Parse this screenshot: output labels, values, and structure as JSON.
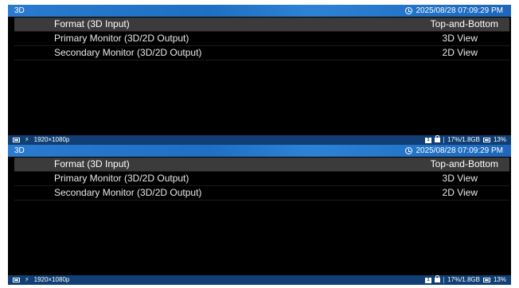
{
  "screens": [
    {
      "title": "3D",
      "datetime": "2025/08/28 07:09:29 PM",
      "menu": [
        {
          "label": "Format (3D Input)",
          "value": "Top-and-Bottom"
        },
        {
          "label": "Primary Monitor (3D/2D Output)",
          "value": "3D View"
        },
        {
          "label": "Secondary Monitor (3D/2D Output)",
          "value": "2D View"
        }
      ],
      "status": {
        "resolution": "1920×1080p",
        "card_badge": "1",
        "storage": "17%/1.8GB",
        "network": "13%"
      }
    },
    {
      "title": "3D",
      "datetime": "2025/08/28 07:09:29 PM",
      "menu": [
        {
          "label": "Format (3D Input)",
          "value": "Top-and-Bottom"
        },
        {
          "label": "Primary Monitor (3D/2D Output)",
          "value": "3D View"
        },
        {
          "label": "Secondary Monitor (3D/2D Output)",
          "value": "2D View"
        }
      ],
      "status": {
        "resolution": "1920×1080p",
        "card_badge": "1",
        "storage": "17%/1.8GB",
        "network": "13%"
      }
    }
  ],
  "colors": {
    "topbar": "#1f6fc4",
    "statusbar": "#0f3f74",
    "selected_row": "#3b3b3b",
    "background": "#000000"
  }
}
